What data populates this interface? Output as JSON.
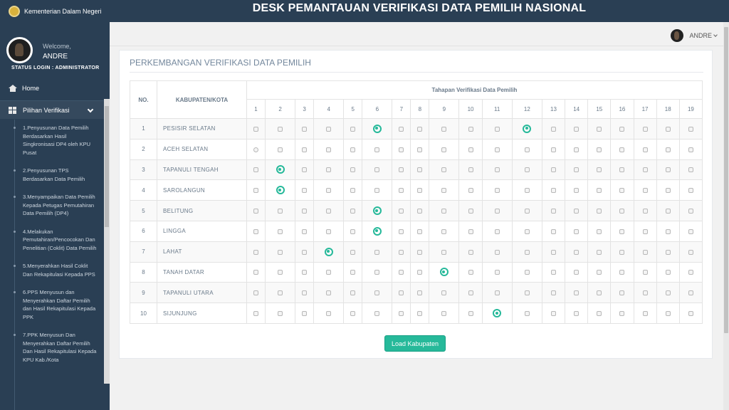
{
  "header": {
    "brand": "Kementerian Dalam Negeri",
    "title": "DESK PEMANTAUAN VERIFIKASI DATA PEMILIH NASIONAL"
  },
  "sidebar": {
    "welcome": "Welcome,",
    "username": "ANDRE",
    "status_login": "STATUS LOGIN : ADMINISTRATOR",
    "home_label": "Home",
    "verifikasi_label": "Pilihan Verifikasi",
    "submenu": [
      "1.Penyusunan Data Pemilih Berdasarkan Hasil Singkronisasi DP4 oleh KPU Pusat",
      "2.Penyusunan TPS Berdasarkan Data Pemilih",
      "3.Menyampaikan Data Pemilih Kepada Petugas Pemutahiran Data Pemilih (DP4)",
      "4.Melakukan Pemutahiran/Pencocokan Dan Penelitian (Coklit) Data Pemilih",
      "5.Menyerahkan Hasil Coklit Dan Rekapitulasi Kepada PPS",
      "6.PPS Menyusun dan Menyerahkan Daftar Pemilih dan Hasil Rekapitulasi Kepada PPK",
      "7.PPK Menyusun Dan Menyerahkan Daftar Pemilih Dan Hasil Rekapitulasi Kepada KPU Kab./Kota"
    ]
  },
  "user_menu": {
    "name": "ANDRE"
  },
  "panel": {
    "title": "PERKEMBANGAN VERIFIKASI DATA PEMILIH",
    "col_no": "NO.",
    "col_kab": "KABUPATEN/KOTA",
    "col_tahapan": "Tahapan Verifikasi Data Pemilih",
    "stages": [
      "1",
      "2",
      "3",
      "4",
      "5",
      "6",
      "7",
      "8",
      "9",
      "10",
      "11",
      "12",
      "13",
      "14",
      "15",
      "16",
      "17",
      "18",
      "19"
    ],
    "rows": [
      {
        "no": "1",
        "name": "PESISIR SELATAN",
        "selected": [
          6,
          12
        ]
      },
      {
        "no": "2",
        "name": "ACEH SELATAN",
        "selected": []
      },
      {
        "no": "3",
        "name": "TAPANULI TENGAH",
        "selected": [
          2
        ]
      },
      {
        "no": "4",
        "name": "SAROLANGUN",
        "selected": [
          2
        ]
      },
      {
        "no": "5",
        "name": "BELITUNG",
        "selected": [
          6
        ]
      },
      {
        "no": "6",
        "name": "LINGGA",
        "selected": [
          6
        ]
      },
      {
        "no": "7",
        "name": "LAHAT",
        "selected": [
          4
        ]
      },
      {
        "no": "8",
        "name": "TANAH DATAR",
        "selected": [
          9
        ]
      },
      {
        "no": "9",
        "name": "TAPANULI UTARA",
        "selected": []
      },
      {
        "no": "10",
        "name": "SIJUNJUNG",
        "selected": [
          11
        ]
      }
    ],
    "load_button": "Load Kabupaten"
  },
  "colors": {
    "accent": "#26b99a",
    "sidebar": "#2a3f54"
  }
}
